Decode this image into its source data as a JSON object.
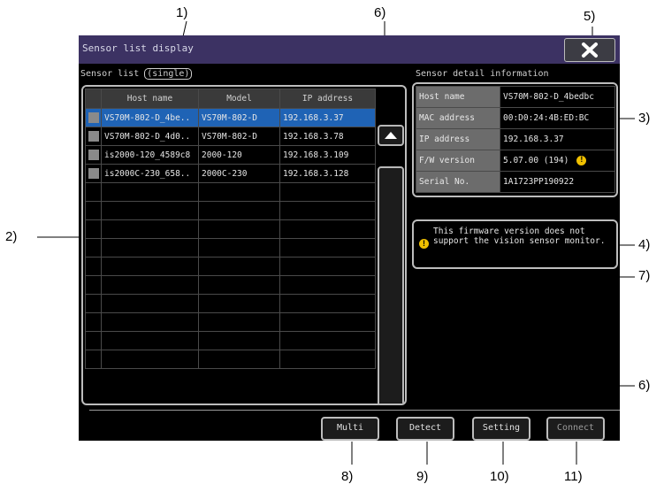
{
  "screen": {
    "title": "Sensor list display",
    "close_button": "close"
  },
  "sensor_list": {
    "label": "Sensor list",
    "mode": "(single)",
    "columns": [
      "",
      "Host name",
      "Model",
      "IP address"
    ],
    "rows": [
      {
        "host": "VS70M-802-D_4be..",
        "model": "VS70M-802-D",
        "ip": "192.168.3.37",
        "selected": true
      },
      {
        "host": "VS70M-802-D_4d0..",
        "model": "VS70M-802-D",
        "ip": "192.168.3.78",
        "selected": false
      },
      {
        "host": "is2000-120_4589c8",
        "model": "2000-120",
        "ip": "192.168.3.109",
        "selected": false
      },
      {
        "host": "is2000C-230_658..",
        "model": "2000C-230",
        "ip": "192.168.3.128",
        "selected": false
      }
    ],
    "empty_rows": 10
  },
  "detail": {
    "label": "Sensor detail information",
    "rows": [
      {
        "key": "Host name",
        "value": "VS70M-802-D_4bedbc"
      },
      {
        "key": "MAC address",
        "value": "00:D0:24:4B:ED:BC"
      },
      {
        "key": "IP address",
        "value": "192.168.3.37"
      },
      {
        "key": "F/W version",
        "value": "5.07.00 (194)",
        "warning": true
      },
      {
        "key": "Serial No.",
        "value": "1A1723PP190922"
      }
    ]
  },
  "message": {
    "icon": "warning-icon",
    "text": "This firmware version does not support the vision sensor monitor."
  },
  "buttons": {
    "multi": "Multi",
    "detect": "Detect",
    "setting": "Setting",
    "connect": "Connect"
  },
  "callouts": {
    "c1": "1)",
    "c2": "2)",
    "c3": "3)",
    "c4": "4)",
    "c5": "5)",
    "c6a": "6)",
    "c6b": "6)",
    "c7": "7)",
    "c8": "8)",
    "c9": "9)",
    "c10": "10)",
    "c11": "11)"
  },
  "colors": {
    "title_bar": "#3c3263",
    "selection": "#1f63b5",
    "warning": "#f0c000"
  }
}
